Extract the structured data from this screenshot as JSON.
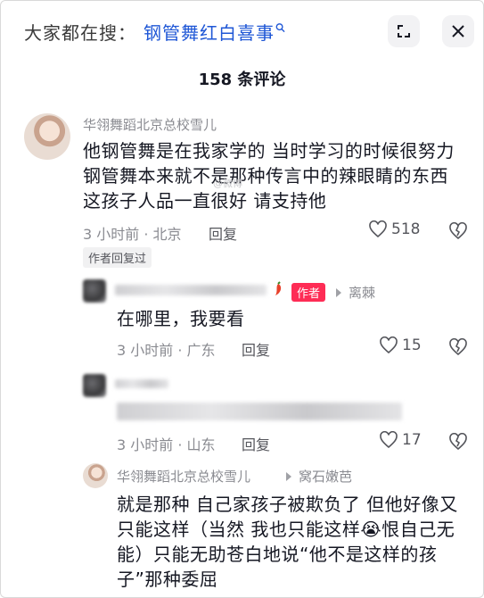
{
  "search": {
    "prefix": "大家都在搜：",
    "query": "钢管舞红白喜事"
  },
  "icons": {
    "expand": "expand-icon",
    "close": "close-icon",
    "search": "search-icon",
    "heart": "heart-icon",
    "dislike": "broken-heart-icon"
  },
  "comments_header": "158 条评论",
  "comment1": {
    "username": "华翎舞蹈北京总校雪儿",
    "lines": [
      "他钢管舞是在我家学的 当时学习的时候很努力",
      "钢管舞本来就不是那种传言中的辣眼睛的东西",
      "这孩子人品一直很好 请支持他"
    ],
    "time_location": "3 小时前 · 北京",
    "reply_label": "回复",
    "likes": "518"
  },
  "author_replied_label": "作者回复过",
  "reply1": {
    "author_tag": "作者",
    "reply_to": "离棘",
    "text": "在哪里，我要看",
    "time_location": "3 小时前 · 广东",
    "reply_label": "回复",
    "likes": "15"
  },
  "reply2": {
    "time_location": "3 小时前 · 山东",
    "reply_label": "回复",
    "likes": "17"
  },
  "reply3": {
    "username": "华翎舞蹈北京总校雪儿",
    "reply_to": "窝石嫩芭",
    "lines": [
      "就是那种 自己家孩子被欺负了 但他好像又",
      "只能这样（当然 我也只能这样😭恨自己无",
      "能）只能无助苍白地说“他不是这样的孩",
      "子”那种委屈"
    ]
  }
}
